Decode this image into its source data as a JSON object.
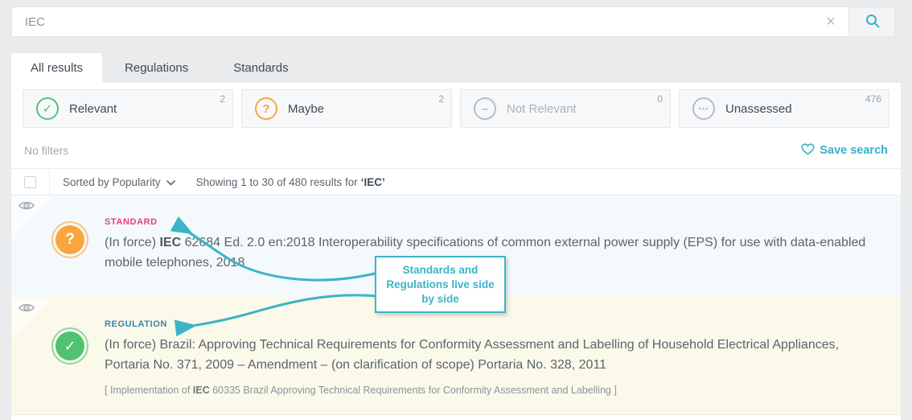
{
  "search": {
    "value": "IEC",
    "clear_icon": "×"
  },
  "tabs": [
    {
      "label": "All results",
      "active": true
    },
    {
      "label": "Regulations",
      "active": false
    },
    {
      "label": "Standards",
      "active": false
    }
  ],
  "filters": [
    {
      "label": "Relevant",
      "count": "2",
      "icon": "✓"
    },
    {
      "label": "Maybe",
      "count": "2",
      "icon": "?"
    },
    {
      "label": "Not Relevant",
      "count": "0",
      "icon": "–"
    },
    {
      "label": "Unassessed",
      "count": "476",
      "icon": "•••"
    }
  ],
  "filter_bar": {
    "no_filters": "No filters",
    "save_search": "Save search"
  },
  "sort_bar": {
    "sorted_by": "Sorted by Popularity",
    "showing": "Showing 1 to 30 of 480 results for",
    "query": "‘IEC’"
  },
  "results": [
    {
      "type_label": "STANDARD",
      "badge": "?",
      "title_prefix": "(In force) ",
      "title_bold": "IEC",
      "title_rest": " 62684 Ed. 2.0 en:2018 Interoperability specifications of common external power supply (EPS) for use with data-enabled mobile telephones, 2018"
    },
    {
      "type_label": "REGULATION",
      "badge": "✓",
      "title": "(In force) Brazil: Approving Technical Requirements for Conformity Assessment and Labelling of Household Electrical Appliances, Portaria No. 371, 2009 – Amendment – (on clarification of scope) Portaria No. 328, 2011",
      "sub_prefix": "[ Implementation of ",
      "sub_bold": "IEC",
      "sub_rest": " 60335 Brazil Approving Technical Requirements for Conformity Assessment and Labelling ]"
    }
  ],
  "callout": {
    "text": "Standards and Regulations live side by side"
  },
  "colors": {
    "accent_teal": "#35b3c9",
    "standard_pink": "#ee3d77",
    "regulation_blue": "#3884a9",
    "relevant_green": "#50c272",
    "maybe_orange": "#f8a63d",
    "page_bg": "#e9ebec"
  }
}
